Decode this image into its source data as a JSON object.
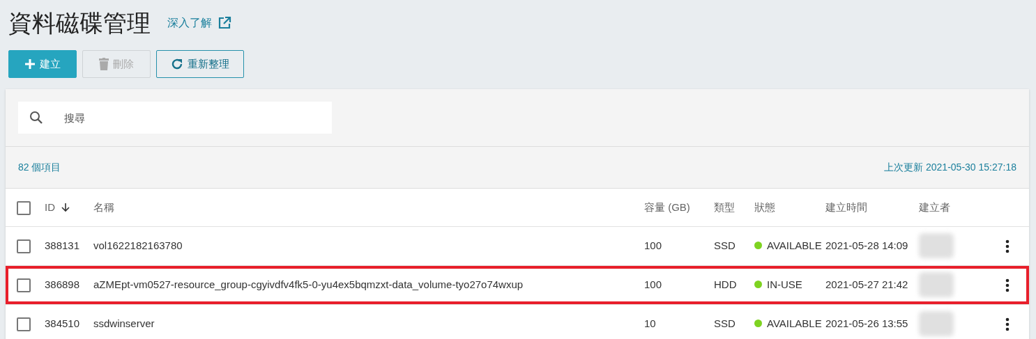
{
  "page": {
    "title": "資料磁碟管理",
    "learn_more": "深入了解"
  },
  "buttons": [
    {
      "label": "建立",
      "kind": "create",
      "disabled": false
    },
    {
      "label": "刪除",
      "kind": "delete",
      "disabled": true
    },
    {
      "label": "重新整理",
      "kind": "refresh",
      "disabled": false
    }
  ],
  "search": {
    "placeholder": "搜尋"
  },
  "summary": {
    "count": "82 個項目",
    "last_updated": "上次更新 2021-05-30 15:27:18"
  },
  "table": {
    "all_checked": false,
    "columns": [
      {
        "label": "ID",
        "sort_descending": true
      },
      {
        "label": "名稱"
      },
      {
        "label": "容量 (GB)"
      },
      {
        "label": "類型"
      },
      {
        "label": "狀態"
      },
      {
        "label": "建立時間"
      },
      {
        "label": "建立者"
      }
    ],
    "rows": [
      {
        "checked": false,
        "highlighted": false,
        "id": "388131",
        "name": "vol1622182163780",
        "size": "100",
        "type": "SSD",
        "status": "AVAILABLE",
        "color": "#7ed321",
        "created": "2021-05-28 14:09"
      },
      {
        "checked": false,
        "highlighted": true,
        "id": "386898",
        "name": "aZMEpt-vm0527-resource_group-cgyivdfv4fk5-0-yu4ex5bqmzxt-data_volume-tyo27o74wxup",
        "size": "100",
        "type": "HDD",
        "status": "IN-USE",
        "color": "#7ed321",
        "created": "2021-05-27 21:42"
      },
      {
        "checked": false,
        "highlighted": false,
        "id": "384510",
        "name": "ssdwinserver",
        "size": "10",
        "type": "SSD",
        "status": "AVAILABLE",
        "color": "#7ed321",
        "created": "2021-05-26 13:55"
      }
    ]
  }
}
